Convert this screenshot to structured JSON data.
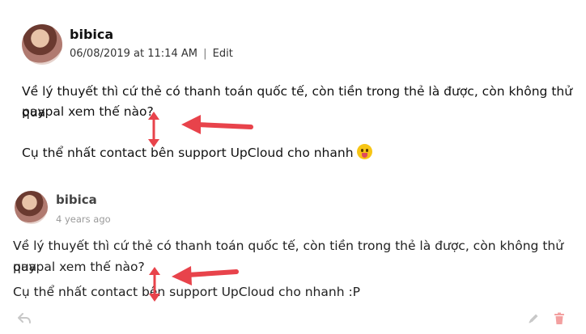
{
  "post1": {
    "author": "bibica",
    "timestamp": "06/08/2019 at 11:14 AM",
    "separator": "|",
    "edit_label": "Edit",
    "line1": "Về lý thuyết thì cứ thẻ có thanh toán quốc tế, còn tiền trong thẻ là được, còn không thử qua",
    "line2": "paypal xem thế nào?",
    "line3": "Cụ thể nhất contact bên support UpCloud cho nhanh"
  },
  "post2": {
    "author": "bibica",
    "timestamp": "4 years ago",
    "line1": "Về lý thuyết thì cứ thẻ có thanh toán quốc tế, còn tiền trong thẻ là được, còn không thử qua",
    "line2": "paypal xem thế nào?",
    "line3": "Cụ thể nhất contact bên support UpCloud cho nhanh :P"
  },
  "icons": {
    "emoji": "stuck-out-tongue-emoji",
    "reply": "reply-icon",
    "edit": "pencil-icon",
    "delete": "trash-icon"
  },
  "colors": {
    "annotation_red": "#e8434b",
    "action_gray": "#c8c8c8",
    "delete_red": "#f3a0a0"
  }
}
